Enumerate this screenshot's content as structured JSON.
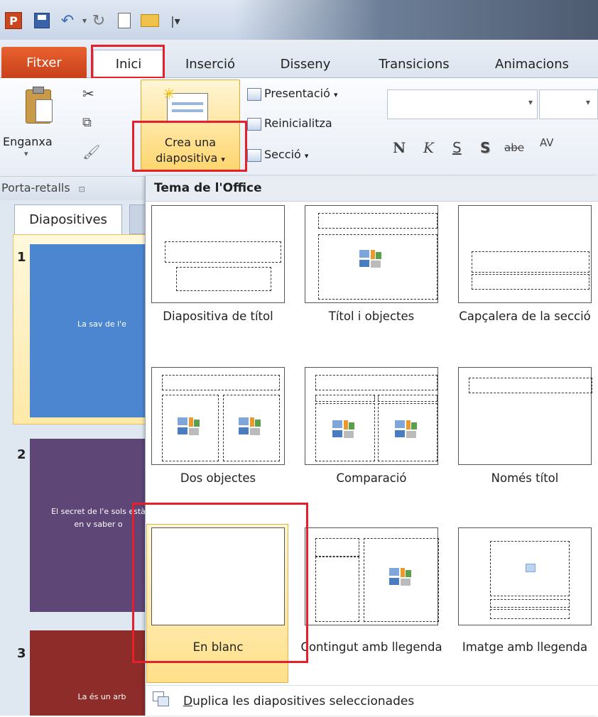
{
  "colors": {
    "file_tab": "#d9542a",
    "highlight": "#e5202a",
    "selected_layout": "#ffe08a",
    "slide1": "#4d86d0",
    "slide2": "#5e4677",
    "slide3": "#8e2c2a"
  },
  "quick_access": [
    "powerpoint-logo-icon",
    "save-icon",
    "undo-icon",
    "redo-icon",
    "new-icon",
    "open-icon",
    "customize-icon"
  ],
  "tabs": [
    {
      "label": "Fitxer"
    },
    {
      "label": "Inici"
    },
    {
      "label": "Inserció"
    },
    {
      "label": "Disseny"
    },
    {
      "label": "Transicions"
    },
    {
      "label": "Animacions"
    }
  ],
  "ribbon": {
    "paste_label": "Enganxa",
    "new_slide_line1": "Crea una",
    "new_slide_line2": "diapositiva",
    "layout_label": "Presentació",
    "reset_label": "Reinicialitza",
    "section_label": "Secció",
    "clipboard_group": "Porta-retalls",
    "font_buttons": [
      "N",
      "K",
      "S",
      "S",
      "abe",
      "AV"
    ]
  },
  "left_pane": {
    "tab_label": "Diapositives",
    "slides": [
      {
        "num": "1",
        "text": "La sav de l'e"
      },
      {
        "num": "2",
        "text": "El secret de l'e sols està en v saber o"
      },
      {
        "num": "3",
        "text": "La és un arb"
      }
    ]
  },
  "gallery": {
    "heading": "Tema de l'Office",
    "layouts": [
      {
        "caption": "Diapositiva de títol"
      },
      {
        "caption": "Títol i objectes"
      },
      {
        "caption": "Capçalera de la secció"
      },
      {
        "caption": "Dos objectes"
      },
      {
        "caption": "Comparació"
      },
      {
        "caption": "Només títol"
      },
      {
        "caption": "En blanc"
      },
      {
        "caption": "Contingut amb llegenda"
      },
      {
        "caption": "Imatge amb llegenda"
      }
    ],
    "duplicate_label": "Duplica les diapositives seleccionades"
  }
}
